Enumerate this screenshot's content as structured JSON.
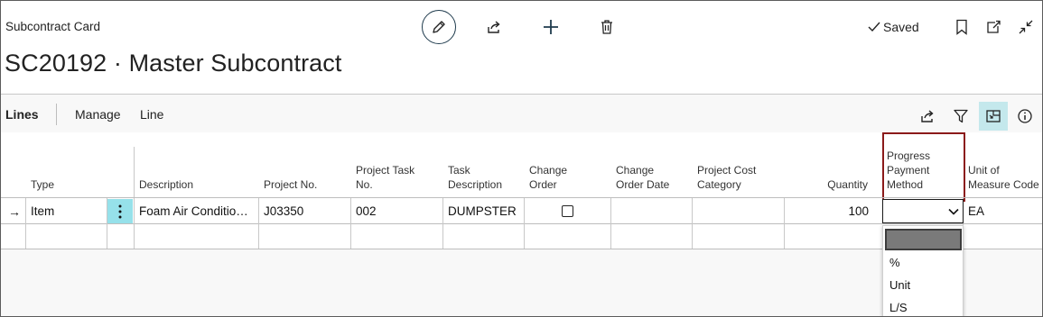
{
  "header": {
    "caption": "Subcontract Card",
    "title": "SC20192 · Master Subcontract",
    "saved_label": "Saved",
    "icons": [
      "edit-icon",
      "share-icon",
      "new-icon",
      "delete-icon",
      "bookmark-icon",
      "open-new-window-icon",
      "collapse-icon"
    ]
  },
  "lines": {
    "title": "Lines",
    "menu": [
      "Manage",
      "Line"
    ],
    "toolbar_icons": [
      "share-icon",
      "filter-icon",
      "focus-mode-icon",
      "info-icon"
    ]
  },
  "columns": {
    "type": "Type",
    "description": "Description",
    "project_no": "Project No.",
    "project_task_no_1": "Project Task",
    "project_task_no_2": "No.",
    "task_description_1": "Task",
    "task_description_2": "Description",
    "change_order_1": "Change",
    "change_order_2": "Order",
    "change_order_date_1": "Change",
    "change_order_date_2": "Order Date",
    "project_cost_category_1": "Project Cost",
    "project_cost_category_2": "Category",
    "quantity": "Quantity",
    "progress_payment_method_1": "Progress",
    "progress_payment_method_2": "Payment",
    "progress_payment_method_3": "Method",
    "unit_of_measure_1": "Unit of",
    "unit_of_measure_2": "Measure Code"
  },
  "rows": [
    {
      "indicator": "→",
      "type": "Item",
      "description": "Foam Air Conditio…",
      "project_no": "J03350",
      "project_task_no": "002",
      "task_description": "DUMPSTER",
      "change_order": false,
      "change_order_date": "",
      "project_cost_category": "",
      "quantity": "100",
      "progress_payment_method": "",
      "unit_of_measure_code": "EA"
    }
  ],
  "dropdown": {
    "options": [
      "%",
      "Unit",
      "L/S"
    ],
    "highlighted_option": ""
  },
  "colors": {
    "accent_highlight": "#96e1ea",
    "focus_button": "#c4e8ec",
    "annotation_box": "#8b1a1a"
  }
}
